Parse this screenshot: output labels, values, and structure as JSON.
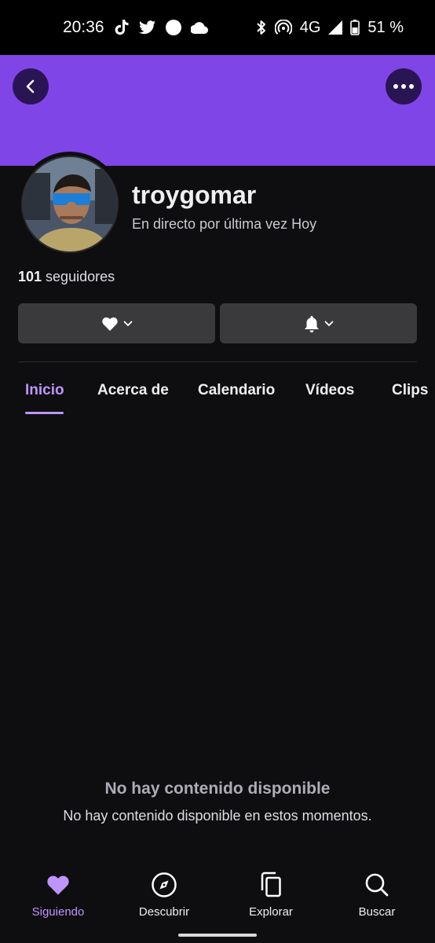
{
  "status_bar": {
    "time": "20:36",
    "network": "4G",
    "battery": "51 %",
    "icons_left": [
      "tiktok-icon",
      "twitter-icon",
      "circle-notification-icon",
      "cloud-icon"
    ],
    "icons_right": [
      "bluetooth-icon",
      "hotspot-icon",
      "signal-icon",
      "battery-icon"
    ]
  },
  "colors": {
    "banner": "#8045e6",
    "accent": "#bf94ff",
    "background": "#0e0e10",
    "button_bg": "#3a3a3d"
  },
  "profile": {
    "username": "troygomar",
    "last_live": "En directo por última vez Hoy",
    "followers_count": "101",
    "followers_label": " seguidores"
  },
  "actions": {
    "follow_icon": "heart-icon",
    "notifications_icon": "bell-icon"
  },
  "tabs": [
    {
      "label": "Inicio",
      "active": true
    },
    {
      "label": "Acerca de",
      "active": false
    },
    {
      "label": "Calendario",
      "active": false
    },
    {
      "label": "Vídeos",
      "active": false
    },
    {
      "label": "Clips",
      "active": false
    }
  ],
  "empty_state": {
    "title": "No hay contenido disponible",
    "subtitle": "No hay contenido disponible en estos momentos."
  },
  "bottom_nav": [
    {
      "label": "Siguiendo",
      "icon": "heart-icon",
      "active": true
    },
    {
      "label": "Descubrir",
      "icon": "compass-icon",
      "active": false
    },
    {
      "label": "Explorar",
      "icon": "copy-icon",
      "active": false
    },
    {
      "label": "Buscar",
      "icon": "search-icon",
      "active": false
    }
  ]
}
